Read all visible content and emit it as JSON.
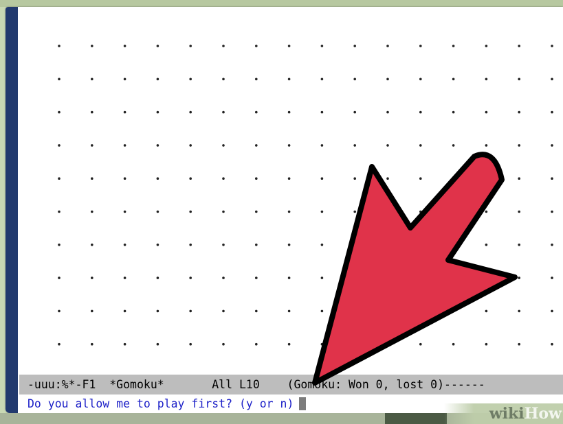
{
  "board": {
    "rows": 10,
    "cols": 16
  },
  "mode_line": {
    "status": "-uuu:%*-F1",
    "buffer_name": "*Gomoku*",
    "position": "All L10",
    "mode_info": "(Gomoku: Won 0, lost 0)------"
  },
  "minibuffer": {
    "prompt": "Do you allow me to play first? (y or n)"
  },
  "watermark": {
    "part1": "wiki",
    "part2": "How"
  },
  "icons": {
    "pointer": "red-arrow-icon"
  },
  "colors": {
    "left_bar": "#223a6e",
    "mode_line_bg": "#bdbdbd",
    "prompt_text": "#1e22c8",
    "arrow_fill": "#e0334a",
    "arrow_stroke": "#000000"
  }
}
